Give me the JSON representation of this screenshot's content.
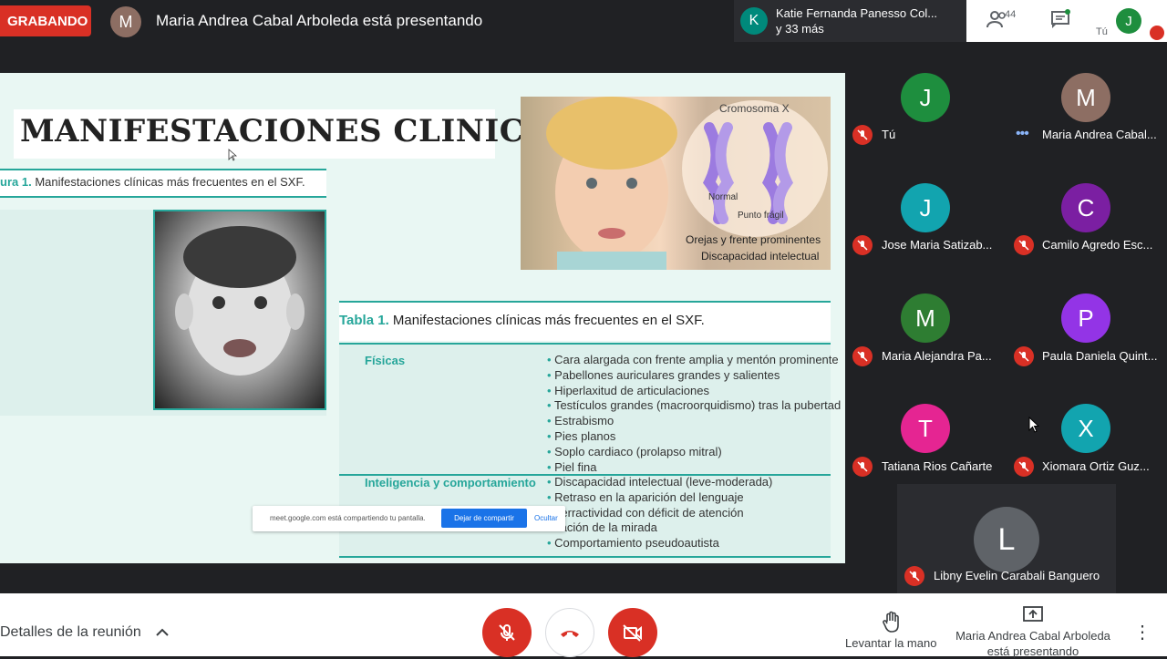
{
  "topbar": {
    "recording_label": "GRABANDO",
    "presenter_initial": "M",
    "presenter_text": "Maria Andrea Cabal Arboleda está presentando",
    "notify_initial": "K",
    "notify_line1": "Katie Fernanda Panesso Col...",
    "notify_line2": "y 33 más",
    "people_count": "44",
    "you_label": "Tú",
    "me_initial": "J"
  },
  "slide": {
    "title": "MANIFESTACIONES CLINICAS",
    "figure_label": "ura 1.",
    "figure_caption": "Manifestaciones clínicas más frecuentes en el SXF.",
    "chromo_title": "Cromosoma X",
    "chromo_normal": "Normal",
    "chromo_fragil": "Punto frágil",
    "child_caption1": "Orejas y frente prominentes",
    "child_caption2": "Discapacidad intelectual",
    "table_label": "Tabla 1.",
    "table_caption": "Manifestaciones clínicas más frecuentes en el SXF.",
    "categories": [
      {
        "name": "Físicas",
        "items": [
          "Cara alargada con frente amplia y mentón prominente",
          "Pabellones auriculares grandes y salientes",
          "Hiperlaxitud de articulaciones",
          "Testículos grandes (macroorquidismo) tras la pubertad",
          "Estrabismo",
          "Pies planos",
          "Soplo cardiaco (prolapso mitral)",
          "Piel fina"
        ]
      },
      {
        "name": "Inteligencia y comportamiento",
        "items": [
          "Discapacidad intelectual (leve-moderada)",
          "Retraso en la aparición del lenguaje",
          "perractividad con déficit de atención",
          "itación de la mirada",
          "Comportamiento pseudoautista"
        ]
      }
    ]
  },
  "share_bar": {
    "text": "meet.google.com está compartiendo tu pantalla.",
    "stop_label": "Dejar de compartir",
    "hide_label": "Ocultar"
  },
  "participants": [
    {
      "initial": "J",
      "name": "Tú",
      "color": "#1e8e3e"
    },
    {
      "initial": "M",
      "name": "Maria Andrea Cabal...",
      "color": "#8d6e63"
    },
    {
      "initial": "J",
      "name": "Jose Maria Satizab...",
      "color": "#12a4af"
    },
    {
      "initial": "C",
      "name": "Camilo Agredo Esc...",
      "color": "#7b1fa2"
    },
    {
      "initial": "M",
      "name": "Maria Alejandra Pa...",
      "color": "#2e7d32"
    },
    {
      "initial": "P",
      "name": "Paula Daniela Quint...",
      "color": "#9334e6"
    },
    {
      "initial": "T",
      "name": "Tatiana Rios Cañarte",
      "color": "#e52592"
    },
    {
      "initial": "X",
      "name": "Xiomara Ortiz Guz...",
      "color": "#12a4af"
    },
    {
      "initial": "L",
      "name": "Libny Evelin Carabali Banguero",
      "color": "#5f6368"
    }
  ],
  "bottombar": {
    "details_label": "Detalles de la reunión",
    "raise_hand_label": "Levantar la mano",
    "presenting_label": "Maria Andrea Cabal Arboleda está presentando",
    "colors": {
      "danger": "#d93025"
    }
  }
}
